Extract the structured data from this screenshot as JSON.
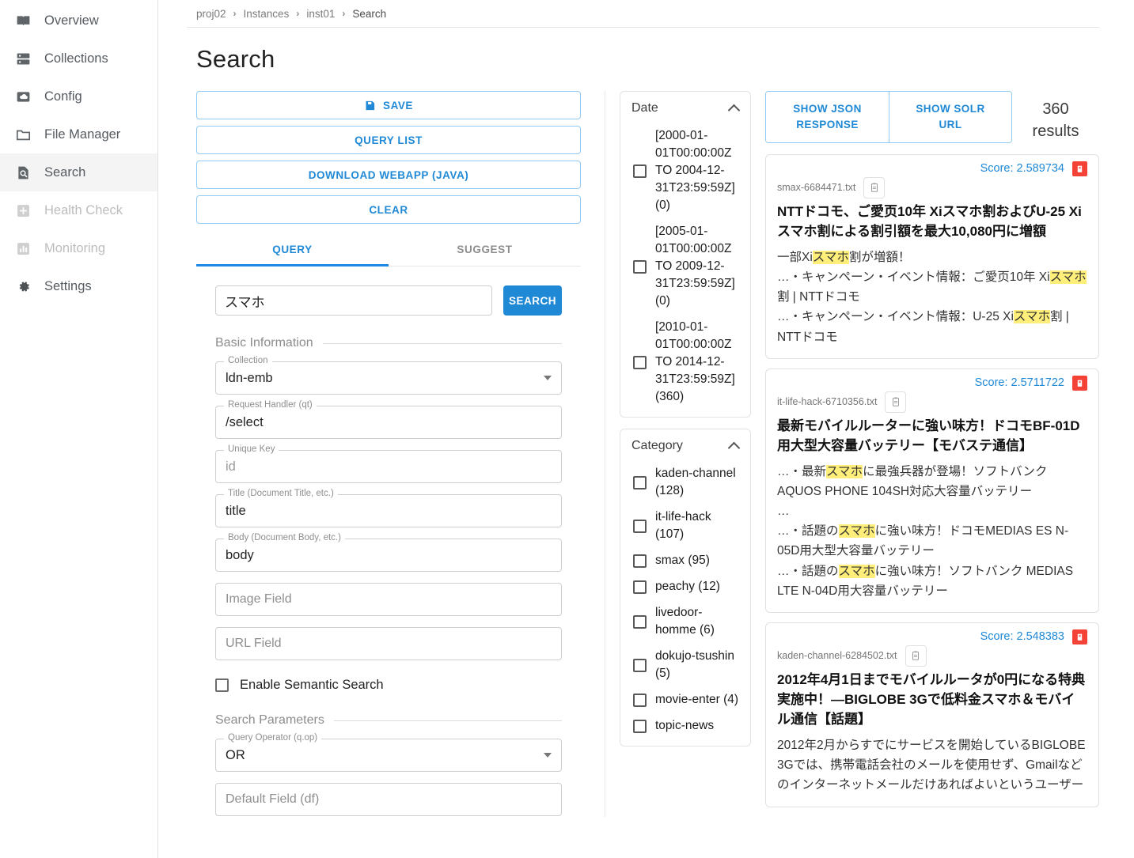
{
  "sidebar": {
    "items": [
      {
        "label": "Overview",
        "icon": "book-icon",
        "state": "normal"
      },
      {
        "label": "Collections",
        "icon": "server-icon",
        "state": "normal"
      },
      {
        "label": "Config",
        "icon": "cloud-box-icon",
        "state": "normal"
      },
      {
        "label": "File Manager",
        "icon": "folder-icon",
        "state": "normal"
      },
      {
        "label": "Search",
        "icon": "search-doc-icon",
        "state": "active"
      },
      {
        "label": "Health Check",
        "icon": "plus-box-icon",
        "state": "disabled"
      },
      {
        "label": "Monitoring",
        "icon": "chart-box-icon",
        "state": "disabled"
      },
      {
        "label": "Settings",
        "icon": "gear-icon",
        "state": "normal"
      }
    ]
  },
  "breadcrumb": {
    "items": [
      "proj02",
      "Instances",
      "inst01",
      "Search"
    ],
    "separator": "›"
  },
  "page": {
    "title": "Search"
  },
  "actions": {
    "save": "SAVE",
    "query_list": "QUERY LIST",
    "download_webapp": "DOWNLOAD WEBAPP (JAVA)",
    "clear": "CLEAR"
  },
  "tabs": [
    {
      "label": "QUERY",
      "active": true
    },
    {
      "label": "SUGGEST",
      "active": false
    }
  ],
  "search": {
    "value": "スマホ",
    "placeholder": "",
    "button": "SEARCH"
  },
  "basic_information": {
    "heading": "Basic Information",
    "fields": [
      {
        "label": "Collection",
        "value": "ldn-emb",
        "type": "select",
        "filled": true
      },
      {
        "label": "Request Handler (qt)",
        "value": "/select",
        "type": "text",
        "filled": true
      },
      {
        "label": "Unique Key",
        "value": "id",
        "type": "text",
        "filled": false
      },
      {
        "label": "Title (Document Title, etc.)",
        "value": "title",
        "type": "text",
        "filled": true
      },
      {
        "label": "Body (Document Body, etc.)",
        "value": "body",
        "type": "text",
        "filled": true
      },
      {
        "label": "",
        "value": "Image Field",
        "type": "text",
        "filled": false
      },
      {
        "label": "",
        "value": "URL Field",
        "type": "text",
        "filled": false
      }
    ],
    "semantic_search": {
      "label": "Enable Semantic Search",
      "checked": false
    }
  },
  "search_parameters": {
    "heading": "Search Parameters",
    "fields": [
      {
        "label": "Query Operator (q.op)",
        "value": "OR",
        "type": "select",
        "filled": true
      },
      {
        "label": "",
        "value": "Default Field (df)",
        "type": "text",
        "filled": false
      }
    ]
  },
  "facets": [
    {
      "title": "Date",
      "items": [
        {
          "label": "[2000-01-01T00:00:00Z TO 2004-12-31T23:59:59Z] (0)",
          "checked": false
        },
        {
          "label": "[2005-01-01T00:00:00Z TO 2009-12-31T23:59:59Z] (0)",
          "checked": false
        },
        {
          "label": "[2010-01-01T00:00:00Z TO 2014-12-31T23:59:59Z] (360)",
          "checked": false
        }
      ]
    },
    {
      "title": "Category",
      "items": [
        {
          "label": "kaden-channel (128)",
          "checked": false
        },
        {
          "label": "it-life-hack (107)",
          "checked": false
        },
        {
          "label": "smax (95)",
          "checked": false
        },
        {
          "label": "peachy (12)",
          "checked": false
        },
        {
          "label": "livedoor-homme (6)",
          "checked": false
        },
        {
          "label": "dokujo-tsushin (5)",
          "checked": false
        },
        {
          "label": "movie-enter (4)",
          "checked": false
        },
        {
          "label": "topic-news",
          "checked": false
        }
      ]
    }
  ],
  "results_header": {
    "show_json": "SHOW JSON\nRESPONSE",
    "show_solr_url": "SHOW SOLR\nURL",
    "count": "360\nresults"
  },
  "results": [
    {
      "score": "Score: 2.589734",
      "file": "smax-6684471.txt",
      "title": "NTTドコモ、ご愛页10年 Xiスマホ割およびU-25 Xiスマホ割による割引額を最大10,080円に増額",
      "snippet_lines": [
        [
          {
            "t": "一部Xi",
            "h": false
          },
          {
            "t": "スマホ",
            "h": true
          },
          {
            "t": "割が増額！",
            "h": false
          }
        ],
        [
          {
            "t": "…・キャンペーン・イベント情報：ご愛页10年 Xi",
            "h": false
          },
          {
            "t": "スマホ",
            "h": true
          },
          {
            "t": "割 | NTTドコモ",
            "h": false
          }
        ],
        [
          {
            "t": "…・キャンペーン・イベント情報：U-25 Xi",
            "h": false
          },
          {
            "t": "スマホ",
            "h": true
          },
          {
            "t": "割 | NTTドコモ",
            "h": false
          }
        ]
      ]
    },
    {
      "score": "Score: 2.5711722",
      "file": "it-life-hack-6710356.txt",
      "title": "最新モバイルルーターに強い味方！ドコモBF-01D用大型大容量バッテリー【モバステ通信】",
      "snippet_lines": [
        [
          {
            "t": "",
            "h": false
          }
        ],
        [
          {
            "t": "…・最新",
            "h": false
          },
          {
            "t": "スマホ",
            "h": true
          },
          {
            "t": "に最強兵器が登場！ソフトバンク AQUOS PHONE 104SH対応大容量バッテリー",
            "h": false
          }
        ],
        [
          {
            "t": "…",
            "h": false
          }
        ],
        [
          {
            "t": "…・話題の",
            "h": false
          },
          {
            "t": "スマホ",
            "h": true
          },
          {
            "t": "に強い味方！ドコモMEDIAS ES N-05D用大型大容量バッテリー",
            "h": false
          }
        ],
        [
          {
            "t": "…・話題の",
            "h": false
          },
          {
            "t": "スマホ",
            "h": true
          },
          {
            "t": "に強い味方！ソフトバンク MEDIAS LTE N-04D用大容量バッテリー",
            "h": false
          }
        ]
      ]
    },
    {
      "score": "Score: 2.548383",
      "file": "kaden-channel-6284502.txt",
      "title": "2012年4月1日までモバイルルータが0円になる特典実施中！—BIGLOBE 3Gで低料金スマホ＆モバイル通信【話題】",
      "snippet_lines": [
        [
          {
            "t": "2012年2月からすでにサービスを開始しているBIGLOBE 3Gでは、携帯電話会社のメールを使用せず、Gmailなどのインターネットメールだけあればよいというユーザー",
            "h": false
          }
        ]
      ]
    }
  ],
  "colors": {
    "accent": "#2089d6",
    "tab_underline": "#1e88e5",
    "highlight": "#ffef7a",
    "danger": "#f44336",
    "sidebar_active_bg": "#f4f4f4"
  }
}
